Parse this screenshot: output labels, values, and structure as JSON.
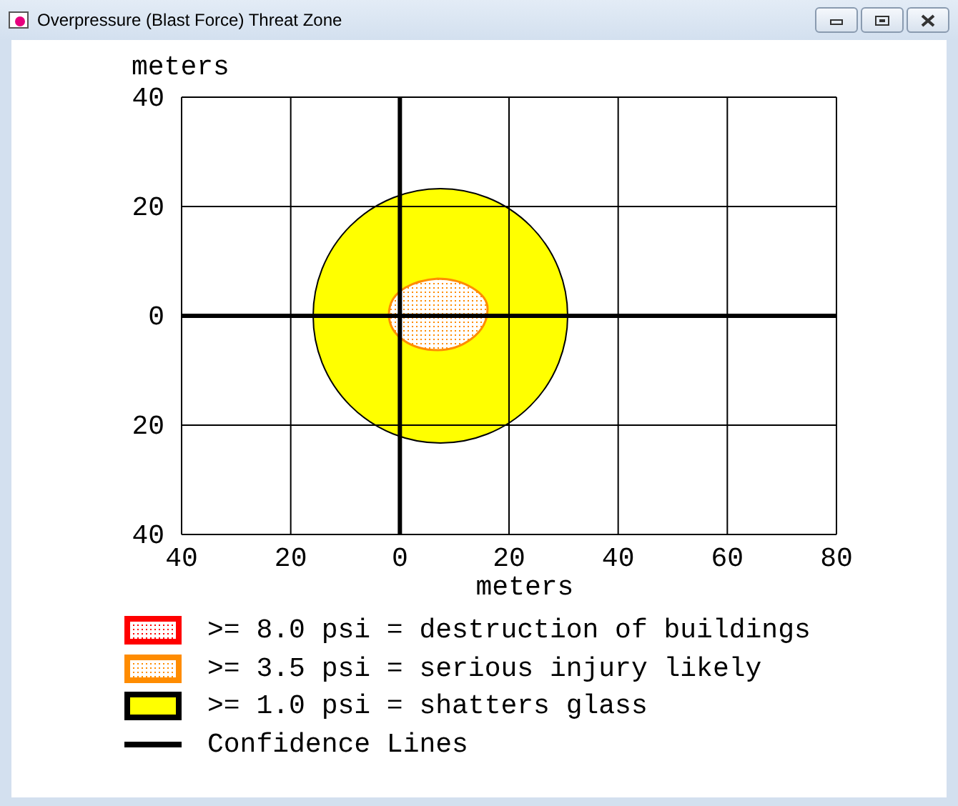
{
  "window": {
    "title": "Overpressure (Blast Force) Threat Zone"
  },
  "plot": {
    "y_label": "meters",
    "x_label": "meters",
    "y_ticks": [
      "40",
      "20",
      "0",
      "20",
      "40"
    ],
    "x_ticks": [
      "40",
      "20",
      "0",
      "20",
      "40",
      "60",
      "80"
    ]
  },
  "legend": [
    {
      "kind": "dotted",
      "color": "#ff0000",
      "label": ">= 8.0 psi = destruction of buildings"
    },
    {
      "kind": "dotted",
      "color": "#ff8c00",
      "label": ">= 3.5 psi = serious injury likely"
    },
    {
      "kind": "solid",
      "color": "#000000",
      "label": ">= 1.0 psi = shatters glass"
    },
    {
      "kind": "line",
      "color": "#000000",
      "label": "Confidence Lines"
    }
  ]
}
